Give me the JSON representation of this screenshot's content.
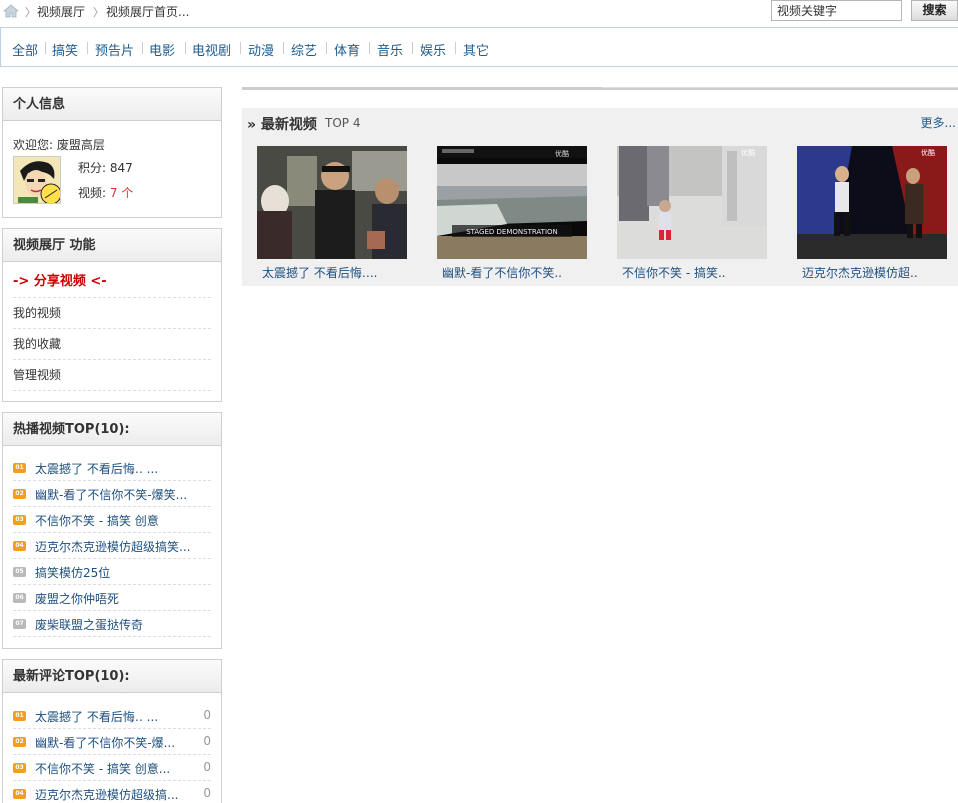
{
  "breadcrumb": {
    "items": [
      "视频展厅",
      "视频展厅首页..."
    ]
  },
  "search": {
    "value": "视频关键字",
    "button_label": "搜索"
  },
  "categories": [
    "全部",
    "搞笑",
    "预告片",
    "电影",
    "电视剧",
    "动漫",
    "综艺",
    "体育",
    "音乐",
    "娱乐",
    "其它"
  ],
  "profile": {
    "title": "个人信息",
    "welcome": "欢迎您: 废盟高层",
    "points_label": "积分:",
    "points_value": "847",
    "videos_label": "视频:",
    "videos_value": "7 个"
  },
  "functions": {
    "title": "视频展厅 功能",
    "items": [
      "-> 分享视频 <-",
      "我的视频",
      "我的收藏",
      "管理视频"
    ]
  },
  "hot_videos": {
    "title": "热播视频TOP(10):",
    "items": [
      {
        "rank": "01",
        "text": "太震撼了 不看后悔‥ ..."
      },
      {
        "rank": "02",
        "text": "幽默-看了不信你不笑-爆笑..."
      },
      {
        "rank": "03",
        "text": "不信你不笑 - 搞笑 创意"
      },
      {
        "rank": "04",
        "text": "迈克尔杰克逊模仿超级搞笑..."
      },
      {
        "rank": "05",
        "text": "搞笑模仿25位"
      },
      {
        "rank": "06",
        "text": "废盟之你仲唔死"
      },
      {
        "rank": "07",
        "text": "废柴联盟之蛋挞传奇"
      }
    ]
  },
  "latest_comments": {
    "title": "最新评论TOP(10):",
    "items": [
      {
        "rank": "01",
        "text": "太震撼了 不看后悔‥ ...",
        "count": "0"
      },
      {
        "rank": "02",
        "text": "幽默-看了不信你不笑-爆...",
        "count": "0"
      },
      {
        "rank": "03",
        "text": "不信你不笑 - 搞笑 创意...",
        "count": "0"
      },
      {
        "rank": "04",
        "text": "迈克尔杰克逊模仿超级搞...",
        "count": "0"
      }
    ]
  },
  "latest_videos": {
    "title": "最新视频",
    "subtitle": "TOP 4",
    "more": "更多...",
    "items": [
      {
        "title": "太震撼了 不看后悔‥.."
      },
      {
        "title": "幽默-看了不信你不笑.."
      },
      {
        "title": "不信你不笑 - 搞笑.."
      },
      {
        "title": "迈克尔杰克逊模仿超.."
      }
    ],
    "thumb_caption": "STAGED DEMONSTRATION",
    "thumb_watermark": "优酷"
  },
  "colors": {
    "link": "#1f5c8e",
    "accent_red": "#cc0000",
    "rank_hot": "#f0a020",
    "rank_cold": "#b9b9b9"
  }
}
